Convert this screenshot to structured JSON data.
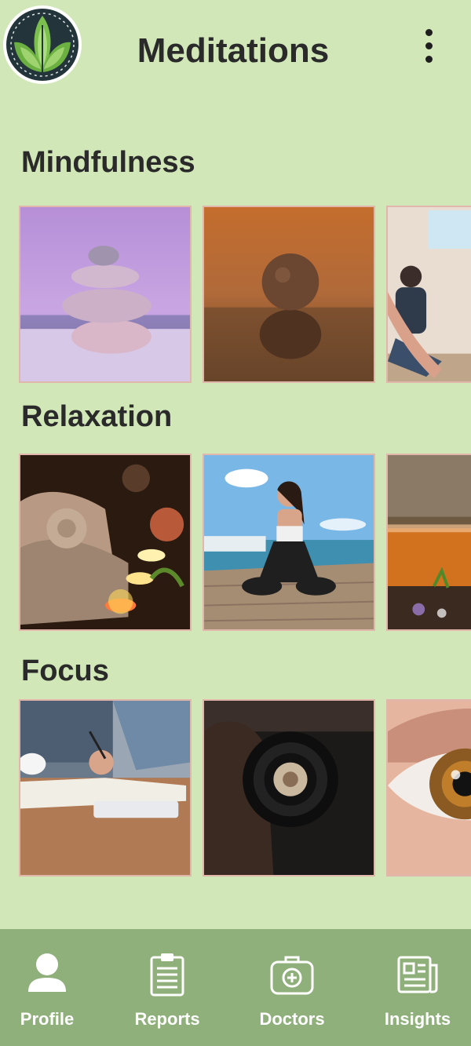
{
  "header": {
    "title": "Meditations",
    "logo_icon": "leaf-logo-icon",
    "menu_icon": "more-vertical-icon"
  },
  "sections": [
    {
      "title": "Mindfulness",
      "tiles": [
        "stacked-pebbles-image",
        "balanced-stones-image",
        "yoga-class-image"
      ]
    },
    {
      "title": "Relaxation",
      "tiles": [
        "spa-towels-candles-image",
        "pier-meditation-image",
        "herbal-tea-image"
      ]
    },
    {
      "title": "Focus",
      "tiles": [
        "writing-notebook-image",
        "camera-lens-image",
        "eye-closeup-image"
      ]
    }
  ],
  "bottom_nav": {
    "items": [
      {
        "label": "Profile",
        "icon": "user-icon"
      },
      {
        "label": "Reports",
        "icon": "clipboard-icon"
      },
      {
        "label": "Doctors",
        "icon": "medical-kit-icon"
      },
      {
        "label": "Insights",
        "icon": "newspaper-icon"
      }
    ]
  },
  "colors": {
    "background": "#d1e7b7",
    "nav_background": "#8fb07b",
    "tile_border": "#e2b7ab",
    "title_text": "#2a2a2a"
  }
}
